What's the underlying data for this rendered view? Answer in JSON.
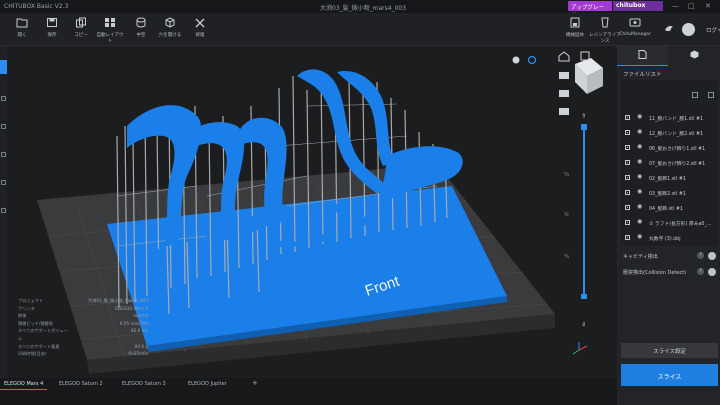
{
  "title_bar": {
    "app_title": "CHITUBOX Basic V2.3",
    "file_title": "大渕03_髪_微小物_mars4_003",
    "upgrade_label": "アップグレード",
    "brand_label": "chitubox",
    "brand_sub": "",
    "window_controls": [
      "—",
      "□",
      "✕"
    ]
  },
  "toolbar": {
    "tools": [
      "開く",
      "保存",
      "コピー",
      "自動レイアウト",
      "中空",
      "穴を開ける",
      "修復"
    ],
    "right_tools": [
      "機械固体",
      "レジンアライアンス",
      "ChituManager"
    ],
    "login_label": "ログイン"
  },
  "right_panel": {
    "file_list_title": "ファイルリスト",
    "files": [
      "11_腕バンド_腕1.stl #1",
      "12_腕バンド_腕2.stl #1",
      "06_髪おさげ飾り1.stl #1",
      "07_髪おさげ飾り2.stl #1",
      "02_髪飾1.stl #1",
      "03_髪飾2.stl #1",
      "04_髪飾.stl #1",
      "① ラフト(長方形) 厚みa0_...",
      "丸数字 (3).obj"
    ],
    "checks": [
      {
        "label": "キャビティ検出"
      },
      {
        "label": "衝突検出(Collision Detect)"
      }
    ],
    "slice_settings_label": "スライス設定",
    "slice_label": "スライス"
  },
  "viewport": {
    "front_label": "Front",
    "slider_labels": [
      "¼",
      "½",
      "¼"
    ],
    "accent_color": "#1a7fe8",
    "support_color": "#a7abaf",
    "info": [
      {
        "key": "プロジェクト",
        "value": "大渕03_髪_微小物_mars4_003"
      },
      {
        "key": "プリンタ",
        "value": "ELEGOO Mars 4"
      },
      {
        "key": "解像",
        "value": "normal"
      },
      {
        "key": "積層ピッチ/積層数",
        "value": "0.05 mm/700"
      },
      {
        "key": "すべてのサポートボリューム",
        "value": "86.6 mL"
      },
      {
        "key": "すべてのサポート重量",
        "value": "90.9 g"
      },
      {
        "key": "印刷時間(目安)",
        "value": "6h35m0s"
      }
    ]
  },
  "bottom_tabs": [
    "ELEGOO Mars 4",
    "ELEGOO Saturn 2",
    "ELEGOO Saturn 3",
    "ELEGOO Jupiter",
    "+"
  ]
}
